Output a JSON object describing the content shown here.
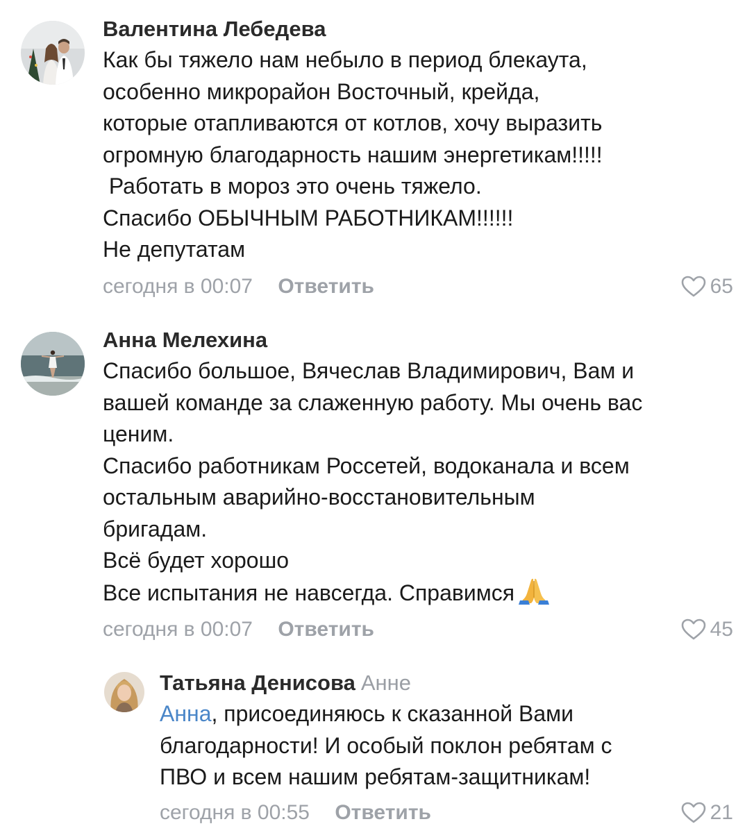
{
  "comments": [
    {
      "author": "Валентина Лебедева",
      "lines": [
        "Как бы тяжело нам небыло в период блекаута,",
        "особенно микрорайон Восточный,  крейда,",
        "которые отапливаются от котлов, хочу выразить",
        "огромную благодарность нашим энергетикам!!!!!",
        " Работать в мороз это очень тяжело.",
        "Спасибо ОБЫЧНЫМ РАБОТНИКАМ!!!!!!",
        "Не депутатам"
      ],
      "time": "сегодня в 00:07",
      "reply_label": "Ответить",
      "likes": "65"
    },
    {
      "author": "Анна Мелехина",
      "lines": [
        "Спасибо большое, Вячеслав Владимирович, Вам и",
        "вашей команде за слаженную работу. Мы очень вас",
        "ценим.",
        "Спасибо работникам Россетей, водоканала и всем",
        "остальным аварийно-восстановительным",
        "бригадам.",
        "Всё будет хорошо",
        "Все испытания не навсегда. Справимся"
      ],
      "emoji": "folded-hands-emoji",
      "time": "сегодня в 00:07",
      "reply_label": "Ответить",
      "likes": "45"
    },
    {
      "author": "Татьяна Денисова",
      "reply_to": "Анне",
      "mention": "Анна",
      "first_line_rest": ", присоединяюсь к сказанной Вами",
      "lines": [
        "благодарности! И особый поклон ребятам с",
        "ПВО и всем нашим ребятам-защитникам!"
      ],
      "time": "сегодня в 00:55",
      "reply_label": "Ответить",
      "likes": "21"
    }
  ],
  "colors": {
    "text": "#1a1a1a",
    "meta": "#9ea2a8",
    "mention": "#4a86c8"
  }
}
